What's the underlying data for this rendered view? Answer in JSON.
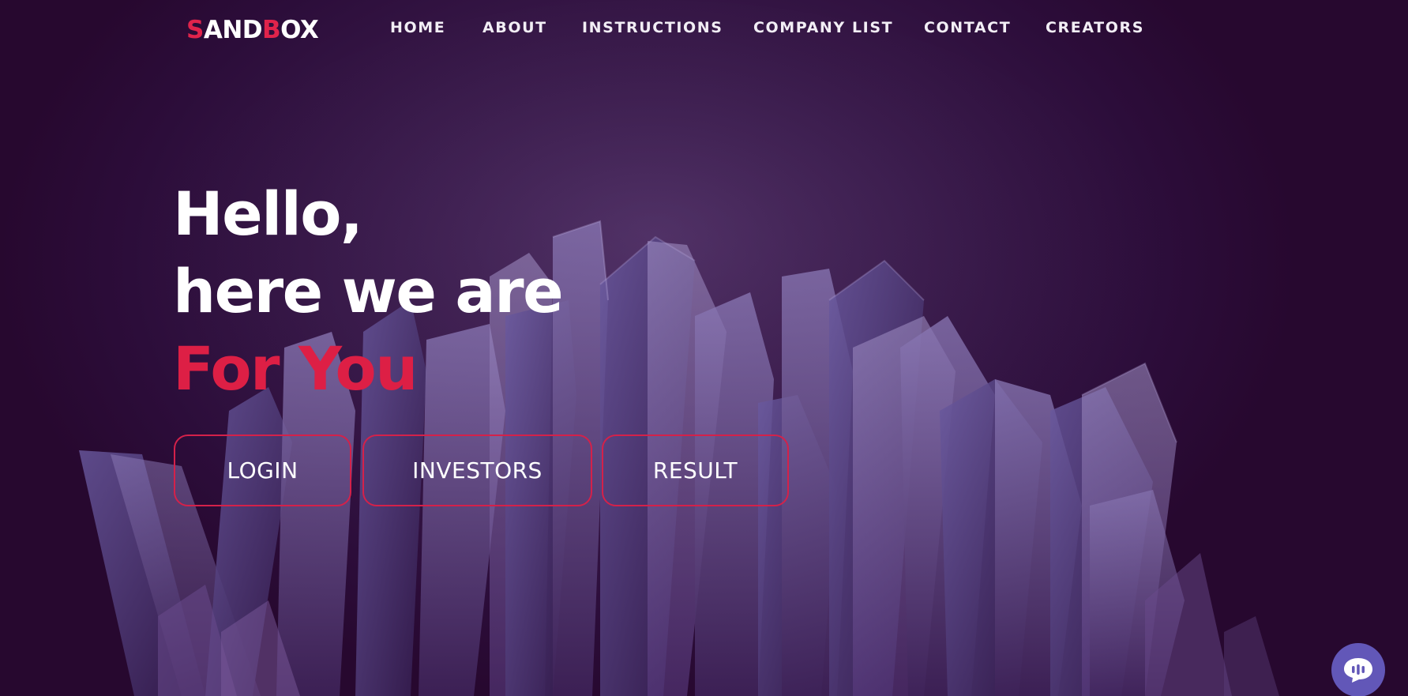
{
  "brand": {
    "logo_first_letter": "S",
    "logo_middle": "AND",
    "logo_b": "B",
    "logo_end": "OX"
  },
  "nav": {
    "items": [
      {
        "label": "HOME"
      },
      {
        "label": "ABOUT"
      },
      {
        "label": "INSTRUCTIONS"
      },
      {
        "label": "COMPANY LIST"
      },
      {
        "label": "CONTACT"
      },
      {
        "label": "CREATORS"
      }
    ]
  },
  "hero": {
    "line1": "Hello,",
    "line2": "here we are",
    "line3": "For You",
    "buttons": [
      {
        "label": "LOGIN"
      },
      {
        "label": "INVESTORS"
      },
      {
        "label": "RESULT"
      }
    ]
  },
  "colors": {
    "accent": "#dd1f45",
    "background": "#2c0d3a",
    "chat_button": "#6257b8"
  },
  "icons": {
    "chat": "chat-bubble-icon"
  }
}
